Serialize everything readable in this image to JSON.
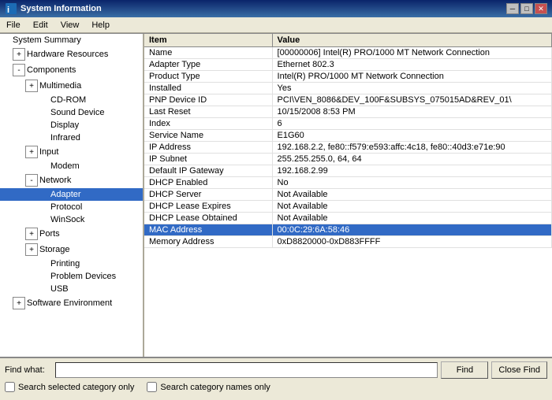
{
  "window": {
    "title": "System Information",
    "controls": {
      "minimize": "─",
      "maximize": "□",
      "close": "✕"
    }
  },
  "menu": {
    "items": [
      "File",
      "Edit",
      "View",
      "Help"
    ]
  },
  "tree": {
    "items": [
      {
        "id": "system-summary",
        "label": "System Summary",
        "indent": 0,
        "expander": null,
        "expanded": false
      },
      {
        "id": "hardware-resources",
        "label": "Hardware Resources",
        "indent": 1,
        "expander": "+",
        "expanded": false
      },
      {
        "id": "components",
        "label": "Components",
        "indent": 1,
        "expander": "-",
        "expanded": true
      },
      {
        "id": "multimedia",
        "label": "Multimedia",
        "indent": 2,
        "expander": "+",
        "expanded": false
      },
      {
        "id": "cd-rom",
        "label": "CD-ROM",
        "indent": 3,
        "expander": null,
        "expanded": false
      },
      {
        "id": "sound-device",
        "label": "Sound Device",
        "indent": 3,
        "expander": null,
        "expanded": false
      },
      {
        "id": "display",
        "label": "Display",
        "indent": 3,
        "expander": null,
        "expanded": false
      },
      {
        "id": "infrared",
        "label": "Infrared",
        "indent": 3,
        "expander": null,
        "expanded": false
      },
      {
        "id": "input",
        "label": "Input",
        "indent": 2,
        "expander": "+",
        "expanded": false
      },
      {
        "id": "modem",
        "label": "Modem",
        "indent": 3,
        "expander": null,
        "expanded": false
      },
      {
        "id": "network",
        "label": "Network",
        "indent": 2,
        "expander": "-",
        "expanded": true
      },
      {
        "id": "adapter",
        "label": "Adapter",
        "indent": 3,
        "expander": null,
        "expanded": false,
        "selected": true
      },
      {
        "id": "protocol",
        "label": "Protocol",
        "indent": 3,
        "expander": null,
        "expanded": false
      },
      {
        "id": "winsock",
        "label": "WinSock",
        "indent": 3,
        "expander": null,
        "expanded": false
      },
      {
        "id": "ports",
        "label": "Ports",
        "indent": 2,
        "expander": "+",
        "expanded": false
      },
      {
        "id": "storage",
        "label": "Storage",
        "indent": 2,
        "expander": "+",
        "expanded": false
      },
      {
        "id": "printing",
        "label": "Printing",
        "indent": 3,
        "expander": null,
        "expanded": false
      },
      {
        "id": "problem-devices",
        "label": "Problem Devices",
        "indent": 3,
        "expander": null,
        "expanded": false
      },
      {
        "id": "usb",
        "label": "USB",
        "indent": 3,
        "expander": null,
        "expanded": false
      },
      {
        "id": "software-environment",
        "label": "Software Environment",
        "indent": 1,
        "expander": "+",
        "expanded": false
      }
    ]
  },
  "table": {
    "columns": [
      "Item",
      "Value"
    ],
    "rows": [
      {
        "item": "Name",
        "value": "[00000006] Intel(R) PRO/1000 MT Network Connection",
        "highlighted": false
      },
      {
        "item": "Adapter Type",
        "value": "Ethernet 802.3",
        "highlighted": false
      },
      {
        "item": "Product Type",
        "value": "Intel(R) PRO/1000 MT Network Connection",
        "highlighted": false
      },
      {
        "item": "Installed",
        "value": "Yes",
        "highlighted": false
      },
      {
        "item": "PNP Device ID",
        "value": "PCI\\VEN_8086&DEV_100F&SUBSYS_075015AD&REV_01\\",
        "highlighted": false
      },
      {
        "item": "Last Reset",
        "value": "10/15/2008 8:53 PM",
        "highlighted": false
      },
      {
        "item": "Index",
        "value": "6",
        "highlighted": false
      },
      {
        "item": "Service Name",
        "value": "E1G60",
        "highlighted": false
      },
      {
        "item": "IP Address",
        "value": "192.168.2.2, fe80::f579:e593:affc:4c18, fe80::40d3:e71e:90",
        "highlighted": false
      },
      {
        "item": "IP Subnet",
        "value": "255.255.255.0, 64, 64",
        "highlighted": false
      },
      {
        "item": "Default IP Gateway",
        "value": "192.168.2.99",
        "highlighted": false
      },
      {
        "item": "DHCP Enabled",
        "value": "No",
        "highlighted": false
      },
      {
        "item": "DHCP Server",
        "value": "Not Available",
        "highlighted": false
      },
      {
        "item": "DHCP Lease Expires",
        "value": "Not Available",
        "highlighted": false
      },
      {
        "item": "DHCP Lease Obtained",
        "value": "Not Available",
        "highlighted": false
      },
      {
        "item": "MAC Address",
        "value": "00:0C:29:6A:58:46",
        "highlighted": true
      },
      {
        "item": "Memory Address",
        "value": "0xD8820000-0xD883FFFF",
        "highlighted": false
      }
    ]
  },
  "bottom": {
    "find_label": "Find what:",
    "find_placeholder": "",
    "find_btn": "Find",
    "close_find_btn": "Close Find",
    "checkbox1_label": "Search selected category only",
    "checkbox2_label": "Search category names only"
  }
}
